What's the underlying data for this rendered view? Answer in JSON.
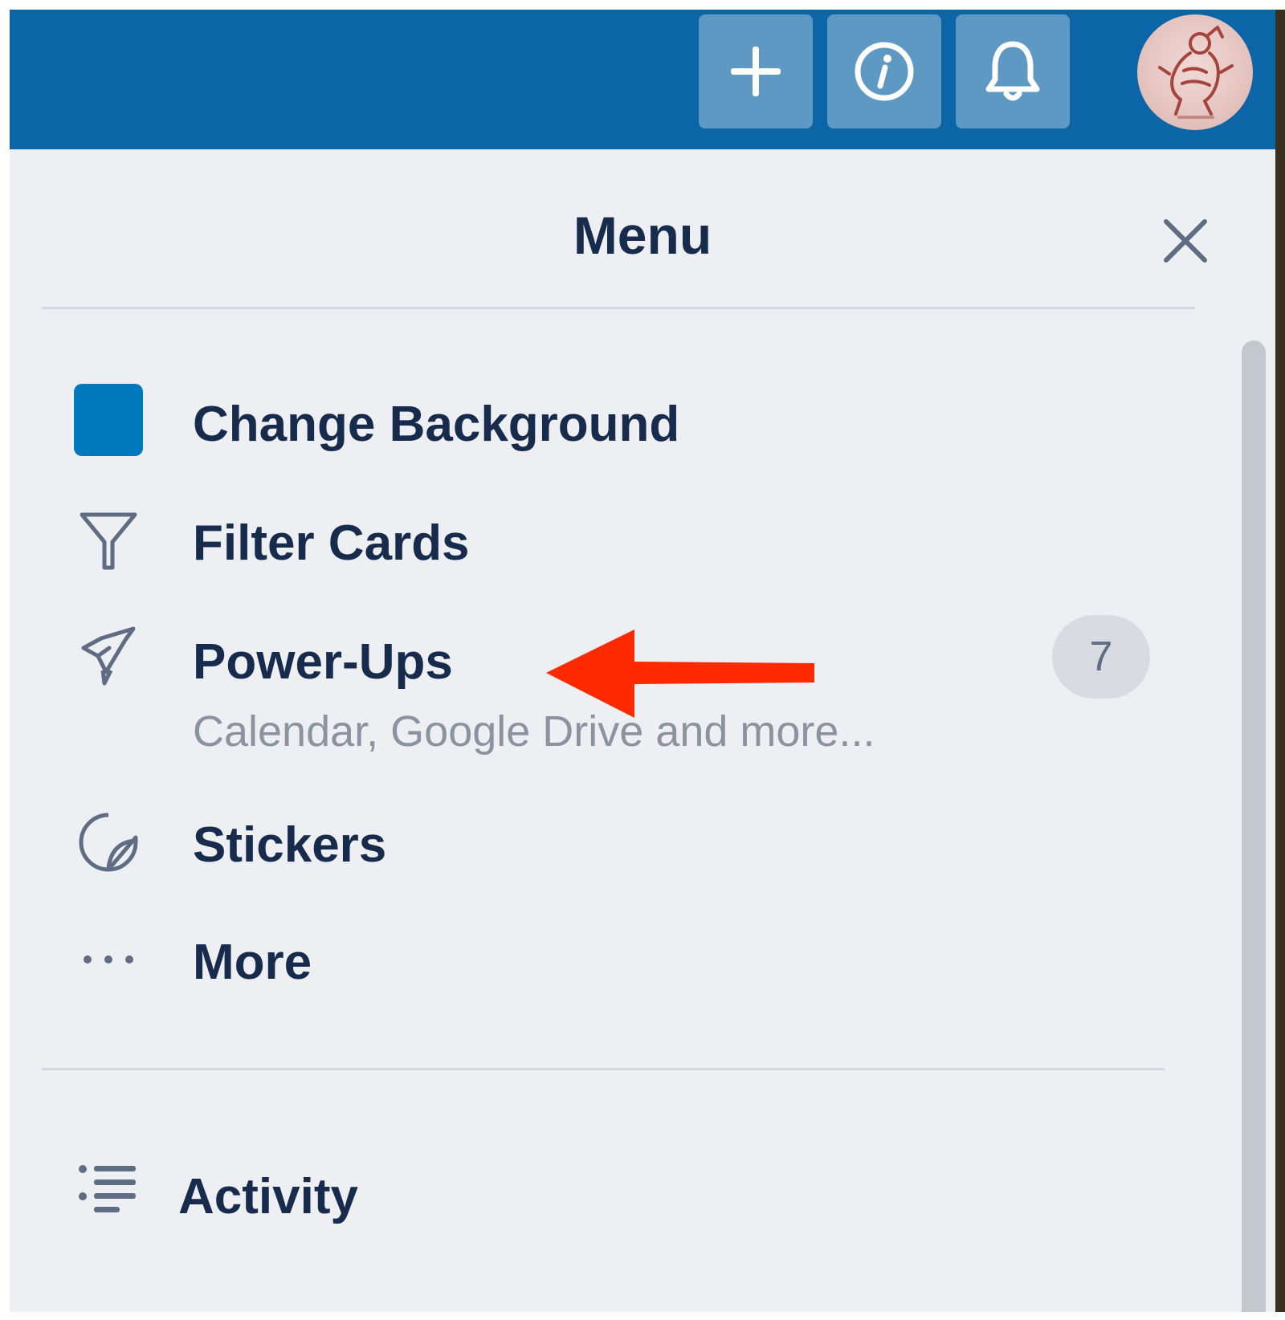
{
  "header": {
    "color": "#0b65a6",
    "buttons": [
      {
        "name": "plus-icon",
        "label": "Create"
      },
      {
        "name": "info-icon",
        "label": "Information"
      },
      {
        "name": "bell-icon",
        "label": "Notifications"
      }
    ],
    "avatar": "user-avatar"
  },
  "panel": {
    "title": "Menu",
    "close_icon": "close-icon",
    "items": [
      {
        "label": "Change Background",
        "icon": "background-swatch",
        "swatch_color": "#0079bf"
      },
      {
        "label": "Filter Cards",
        "icon": "filter-icon"
      },
      {
        "label": "Power-Ups",
        "icon": "rocket-icon",
        "sublabel": "Calendar, Google Drive and more...",
        "badge": "7"
      },
      {
        "label": "Stickers",
        "icon": "sticker-icon"
      },
      {
        "label": "More",
        "icon": "more-icon"
      },
      {
        "label": "Activity",
        "icon": "activity-icon"
      }
    ]
  },
  "annotation": {
    "type": "arrow",
    "color": "#ff2a00",
    "points_to": "Power-Ups"
  }
}
